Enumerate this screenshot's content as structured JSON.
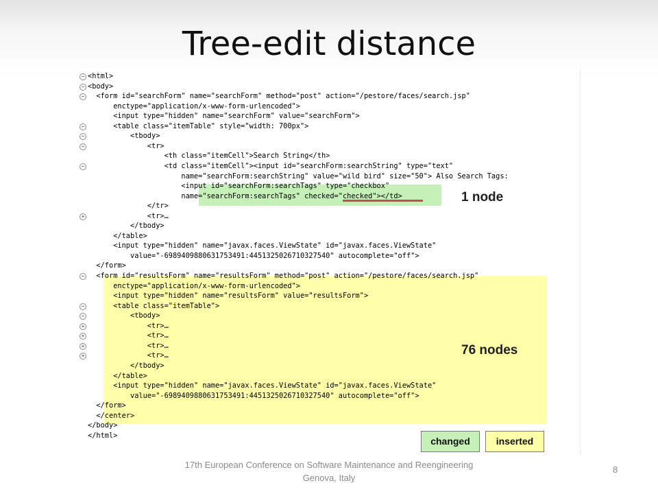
{
  "slide": {
    "title": "Tree-edit distance",
    "footer_line1": "17th European Conference on Software Maintenance and Reengineering",
    "footer_line2": "Genova, Italy",
    "slide_number": "8"
  },
  "annotations": {
    "changed_count": "1 node",
    "inserted_count": "76 nodes"
  },
  "legend": {
    "changed_label": "changed",
    "inserted_label": "inserted",
    "changed_color": "#c5f0b8",
    "inserted_color": "#ffffa9"
  },
  "strike_color": "#c0504d",
  "code": {
    "lines": [
      "<html>",
      "<body>",
      "  <form id=\"searchForm\" name=\"searchForm\" method=\"post\" action=\"/pestore/faces/search.jsp\"",
      "      enctype=\"application/x-www-form-urlencoded\">",
      "      <input type=\"hidden\" name=\"searchForm\" value=\"searchForm\">",
      "      <table class=\"itemTable\" style=\"width: 700px\">",
      "          <tbody>",
      "              <tr>",
      "                  <th class=\"itemCell\">Search String</th>",
      "                  <td class=\"itemCell\"><input id=\"searchForm:searchString\" type=\"text\"",
      "                      name=\"searchForm:searchString\" value=\"wild bird\" size=\"50\"> Also Search Tags:",
      "                      <input id=\"searchForm:searchTags\" type=\"checkbox\"",
      "                      name=\"searchForm:searchTags\" checked=\"checked\"></td>",
      "              </tr>",
      "              <tr>…",
      "          </tbody>",
      "      </table>",
      "      <input type=\"hidden\" name=\"javax.faces.ViewState\" id=\"javax.faces.ViewState\"",
      "          value=\"-6989409880631753491:4451325026710327540\" autocomplete=\"off\">",
      "  </form>",
      "  <form id=\"resultsForm\" name=\"resultsForm\" method=\"post\" action=\"/pestore/faces/search.jsp\"",
      "      enctype=\"application/x-www-form-urlencoded\">",
      "      <input type=\"hidden\" name=\"resultsForm\" value=\"resultsForm\">",
      "      <table class=\"itemTable\">",
      "          <tbody>",
      "              <tr>…",
      "              <tr>…",
      "              <tr>…",
      "              <tr>…",
      "          </tbody>",
      "      </table>",
      "      <input type=\"hidden\" name=\"javax.faces.ViewState\" id=\"javax.faces.ViewState\"",
      "          value=\"-6989409880631753491:4451325026710327540\" autocomplete=\"off\">",
      "  </form>",
      "  </center>",
      "</body>",
      "</html>"
    ],
    "fold_markers": [
      "⊖",
      "⊖",
      "⊖",
      "",
      "",
      "⊖",
      "⊖",
      "⊖",
      "",
      "⊖",
      "",
      "",
      "",
      "",
      "⊕",
      "",
      "",
      "",
      "",
      "",
      "⊖",
      "",
      "",
      "⊖",
      "⊖",
      "⊕",
      "⊕",
      "⊕",
      "⊕",
      "",
      "",
      "",
      "",
      "",
      "",
      "",
      ""
    ]
  }
}
